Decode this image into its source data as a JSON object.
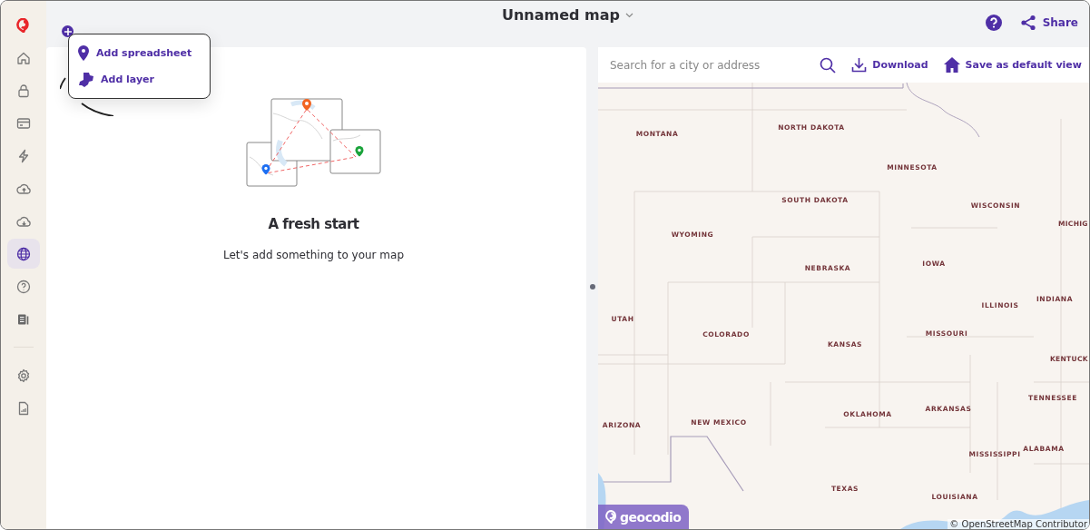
{
  "sidebar": {
    "items": [
      {
        "selected": false
      },
      {
        "selected": false
      },
      {
        "selected": false
      },
      {
        "selected": false
      },
      {
        "selected": false
      },
      {
        "selected": false
      },
      {
        "selected": true
      },
      {
        "selected": false
      },
      {
        "selected": false
      }
    ],
    "footer_items": [
      {
        "selected": false
      },
      {
        "selected": false
      }
    ]
  },
  "header": {
    "title": "Unnamed map",
    "share": "Share"
  },
  "add_menu": {
    "items": [
      {
        "label": "Add spreadsheet",
        "kind": "pin"
      },
      {
        "label": "Add layer",
        "kind": "shape"
      }
    ]
  },
  "empty_state": {
    "title": "A fresh start",
    "message": "Let's add something to your map"
  },
  "map": {
    "search": {
      "placeholder": "Search for a city or address"
    },
    "download": "Download",
    "save_view": "Save as default view",
    "labels": [
      "MONTANA",
      "NORTH DAKOTA",
      "MINNESOTA",
      "SOUTH DAKOTA",
      "WISCONSIN",
      "MICHIG",
      "WYOMING",
      "NEBRASKA",
      "IOWA",
      "ILLINOIS",
      "INDIANA",
      "UTAH",
      "COLORADO",
      "KANSAS",
      "MISSOURI",
      "KENTUCK",
      "ARIZONA",
      "NEW MEXICO",
      "OKLAHOMA",
      "ARKANSAS",
      "TENNESSEE",
      "MISSISSIPPI",
      "ALABAMA",
      "TEXAS",
      "LOUISIANA"
    ],
    "logo": "geocodio",
    "attribution": "© OpenStreetMap Contributor"
  }
}
